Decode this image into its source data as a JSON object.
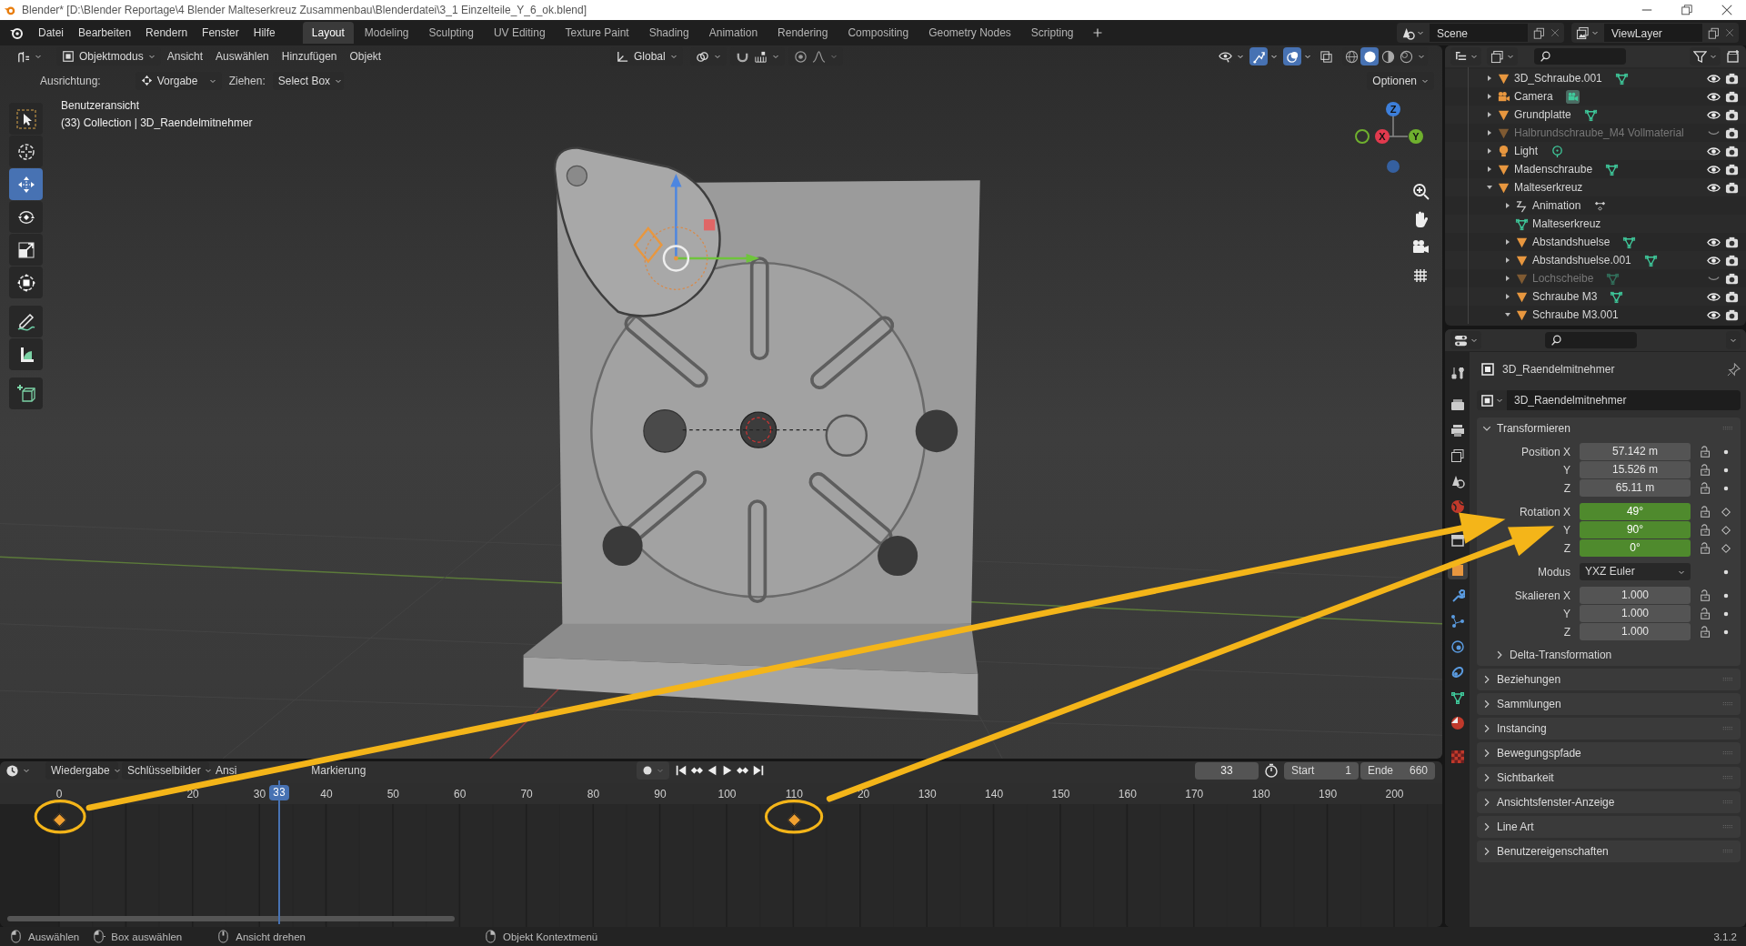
{
  "window": {
    "title": "Blender* [D:\\Blender Reportage\\4 Blender Malteserkreuz Zusammenbau\\Blenderdatei\\3_1 Einzelteile_Y_6_ok.blend]"
  },
  "menu": [
    "Datei",
    "Bearbeiten",
    "Rendern",
    "Fenster",
    "Hilfe"
  ],
  "workspaces": [
    {
      "label": "Layout",
      "selected": true
    },
    {
      "label": "Modeling",
      "selected": false
    },
    {
      "label": "Sculpting",
      "selected": false
    },
    {
      "label": "UV Editing",
      "selected": false
    },
    {
      "label": "Texture Paint",
      "selected": false
    },
    {
      "label": "Shading",
      "selected": false
    },
    {
      "label": "Animation",
      "selected": false
    },
    {
      "label": "Rendering",
      "selected": false
    },
    {
      "label": "Compositing",
      "selected": false
    },
    {
      "label": "Geometry Nodes",
      "selected": false
    },
    {
      "label": "Scripting",
      "selected": false
    }
  ],
  "scene": "Scene",
  "view_layer": "ViewLayer",
  "viewport": {
    "mode": "Objektmodus",
    "menus": [
      "Ansicht",
      "Auswählen",
      "Hinzufügen",
      "Objekt"
    ],
    "orientation": "Global",
    "options": "Optionen",
    "toggles": [
      {
        "kind": "visibility",
        "on": false
      },
      {
        "kind": "gizmo",
        "on": true
      },
      {
        "kind": "overlay",
        "on": true
      },
      {
        "kind": "xray",
        "on": false
      }
    ],
    "shading": [
      {
        "kind": "wireframe",
        "selected": false
      },
      {
        "kind": "solid",
        "selected": true
      },
      {
        "kind": "material",
        "selected": false
      },
      {
        "kind": "rendered",
        "selected": false
      }
    ],
    "tool_settings": {
      "alignment_label": "Ausrichtung:",
      "alignment": "Vorgabe",
      "drag_label": "Ziehen:",
      "drag": "Select Box"
    },
    "view_name": "Benutzeransicht",
    "info": "(33) Collection | 3D_Raendelmitnehmer",
    "tools": [
      {
        "kind": "select",
        "selected": false
      },
      {
        "kind": "cursor",
        "selected": false
      },
      {
        "kind": "move",
        "selected": true
      },
      {
        "kind": "rotate",
        "selected": false
      },
      {
        "kind": "scale",
        "selected": false
      },
      {
        "kind": "transform",
        "selected": false
      },
      {
        "kind": "annotate",
        "selected": false
      },
      {
        "kind": "measure",
        "selected": false
      },
      {
        "kind": "add_cube",
        "selected": false
      }
    ],
    "gizmo": {
      "z": "Z",
      "x": "X",
      "y": "Y"
    }
  },
  "outliner": {
    "items": [
      {
        "name": "3D_Schraube.001",
        "kind": "mesh",
        "expanded": false,
        "visible": true
      },
      {
        "name": "Camera",
        "kind": "camera",
        "expanded": false,
        "visible": true
      },
      {
        "name": "Grundplatte",
        "kind": "mesh",
        "expanded": false,
        "visible": true
      },
      {
        "name": "Halbrundschraube_M4 Vollmaterial",
        "kind": "mesh_plain",
        "expanded": false,
        "visible": false
      },
      {
        "name": "Light",
        "kind": "light",
        "expanded": false,
        "visible": true
      },
      {
        "name": "Madenschraube",
        "kind": "mesh",
        "expanded": false,
        "visible": true
      },
      {
        "name": "Malteserkreuz",
        "kind": "mesh_plain",
        "expanded": true,
        "visible": true,
        "children": [
          {
            "name": "Animation",
            "kind": "animation",
            "expanded": false
          },
          {
            "name": "Malteserkreuz",
            "kind": "mesh_data"
          },
          {
            "name": "Abstandshuelse",
            "kind": "mesh",
            "expanded": false,
            "visible": true
          },
          {
            "name": "Abstandshuelse.001",
            "kind": "mesh",
            "expanded": false,
            "visible": true
          },
          {
            "name": "Lochscheibe",
            "kind": "mesh",
            "expanded": false,
            "visible": false
          },
          {
            "name": "Schraube M3",
            "kind": "mesh",
            "expanded": false,
            "visible": true
          },
          {
            "name": "Schraube M3.001",
            "kind": "mesh_plain",
            "expanded": true,
            "visible": true
          }
        ]
      }
    ]
  },
  "properties": {
    "tabs": [
      {
        "kind": "tool",
        "selected": false
      },
      {
        "kind": "render",
        "selected": false
      },
      {
        "kind": "output",
        "selected": false
      },
      {
        "kind": "view_layer",
        "selected": false
      },
      {
        "kind": "scene",
        "selected": false
      },
      {
        "kind": "world",
        "selected": false
      },
      {
        "kind": "collection",
        "selected": false
      },
      {
        "kind": "object",
        "selected": true
      },
      {
        "kind": "modifiers",
        "selected": false
      },
      {
        "kind": "particles",
        "selected": false
      },
      {
        "kind": "physics",
        "selected": false
      },
      {
        "kind": "constraints",
        "selected": false
      },
      {
        "kind": "data",
        "selected": false
      },
      {
        "kind": "material",
        "selected": false
      },
      {
        "kind": "texture",
        "selected": false
      }
    ],
    "object_name": "3D_Raendelmitnehmer",
    "data_name": "3D_Raendelmitnehmer",
    "transform_title": "Transformieren",
    "transform_groups": [
      [
        {
          "kind": "number",
          "label": "Position X",
          "value": "57.142 m",
          "animated": false
        },
        {
          "kind": "number",
          "label": "Y",
          "value": "15.526 m",
          "animated": false
        },
        {
          "kind": "number",
          "label": "Z",
          "value": "65.11 m",
          "animated": false
        }
      ],
      [
        {
          "kind": "number",
          "label": "Rotation X",
          "value": "49°",
          "animated": true
        },
        {
          "kind": "number",
          "label": "Y",
          "value": "90°",
          "animated": true
        },
        {
          "kind": "number",
          "label": "Z",
          "value": "0°",
          "animated": true
        }
      ],
      [
        {
          "kind": "dropdown",
          "label": "Modus",
          "value": "YXZ Euler"
        }
      ],
      [
        {
          "kind": "number",
          "label": "Skalieren X",
          "value": "1.000",
          "animated": false
        },
        {
          "kind": "number",
          "label": "Y",
          "value": "1.000",
          "animated": false
        },
        {
          "kind": "number",
          "label": "Z",
          "value": "1.000",
          "animated": false
        }
      ]
    ],
    "subpanel": {
      "title": "Delta-Transformation",
      "expanded": false
    },
    "panels": [
      {
        "title": "Beziehungen",
        "expanded": false
      },
      {
        "title": "Sammlungen",
        "expanded": false
      },
      {
        "title": "Instancing",
        "expanded": false
      },
      {
        "title": "Bewegungspfade",
        "expanded": false
      },
      {
        "title": "Sichtbarkeit",
        "expanded": false
      },
      {
        "title": "Ansichtsfenster-Anzeige",
        "expanded": false
      },
      {
        "title": "Line Art",
        "expanded": false
      },
      {
        "title": "Benutzereigenschaften",
        "expanded": false
      }
    ]
  },
  "timeline": {
    "menus": [
      {
        "label": "Wiedergabe",
        "kind": "dropdown"
      },
      {
        "label": "Schlüsselbilder",
        "kind": "dropdown"
      },
      {
        "label": "Ansi",
        "kind": "menu"
      },
      {
        "label": "Markierung",
        "kind": "menu"
      }
    ],
    "current_frame": "33",
    "start_label": "Start",
    "start": "1",
    "end_label": "Ende",
    "end": "660",
    "ticks": [
      "0",
      "20",
      "30",
      "40",
      "50",
      "60",
      "70",
      "80",
      "90",
      "100",
      "110",
      "20",
      "130",
      "140",
      "150",
      "160",
      "170",
      "180",
      "190",
      "200"
    ],
    "current_frame_indicator": "33",
    "keyframes": [
      {
        "selected": true
      },
      {
        "selected": true
      }
    ]
  },
  "status_bar": {
    "hints": [
      {
        "kind": "left",
        "label": "Auswählen"
      },
      {
        "kind": "left_drag",
        "label": "Box auswählen"
      },
      {
        "kind": "middle",
        "label": "Ansicht drehen"
      },
      {
        "kind": "right",
        "label": "Objekt Kontextmenü"
      }
    ],
    "version": "3.1.2"
  }
}
